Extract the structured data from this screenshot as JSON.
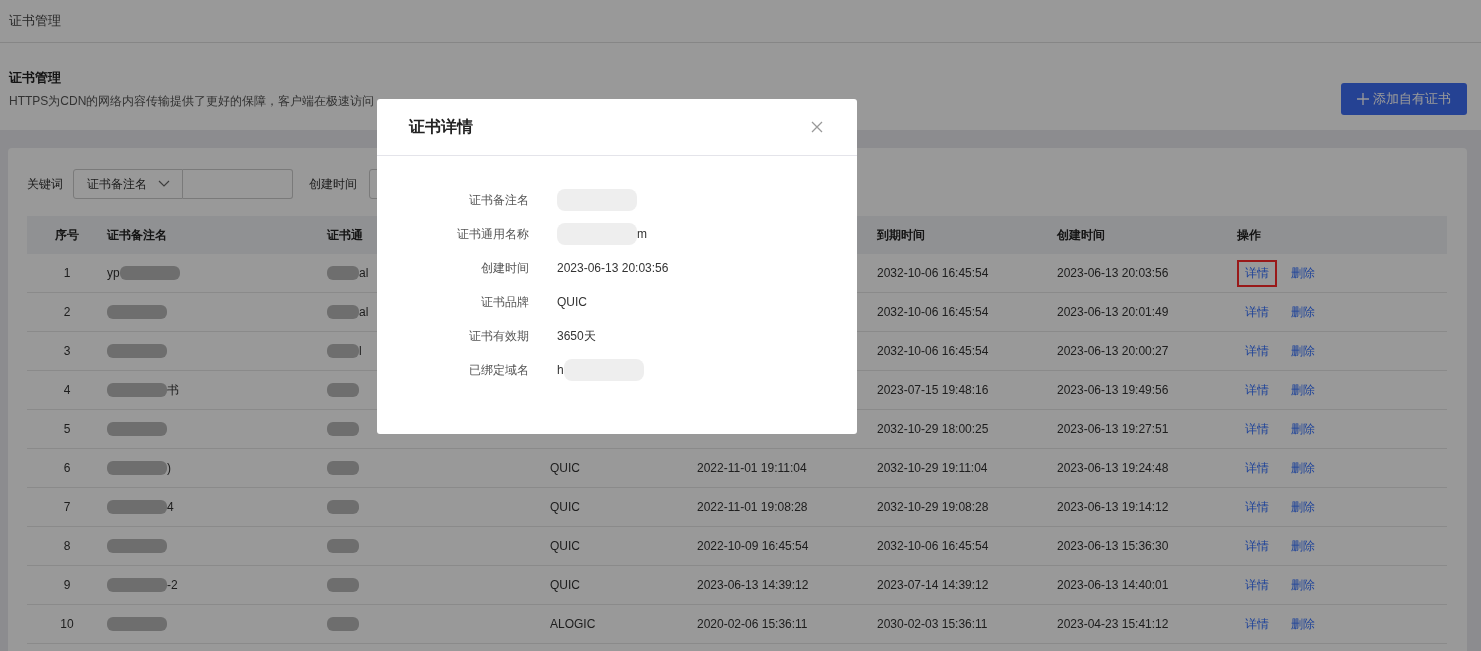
{
  "header": {
    "title": "证书管理"
  },
  "section": {
    "title": "证书管理",
    "description": "HTTPS为CDN的网络内容传输提供了更好的保障，客户端在极速访问",
    "add_button": "添加自有证书"
  },
  "filters": {
    "keyword_label": "关键词",
    "keyword_select": "证书备注名",
    "created_label": "创建时间"
  },
  "table": {
    "columns": [
      "序号",
      "证书备注名",
      "证书通",
      "到期时间",
      "创建时间",
      "操作"
    ],
    "rows": [
      {
        "index": "1",
        "name": {
          "text": "yp",
          "redacted_after": true
        },
        "common": {
          "text": "al",
          "redacted_before": true
        },
        "expire": "2032-10-06 16:45:54",
        "created": "2023-06-13 20:03:56",
        "actions": [
          {
            "label": "详情",
            "highlighted": true
          },
          {
            "label": "删除",
            "highlighted": false
          }
        ]
      },
      {
        "index": "2",
        "name": {
          "redacted_before": true
        },
        "common": {
          "text": "al",
          "redacted_before": true
        },
        "expire": "2032-10-06 16:45:54",
        "created": "2023-06-13 20:01:49",
        "actions": [
          {
            "label": "详情",
            "highlighted": false
          },
          {
            "label": "删除",
            "highlighted": false
          }
        ]
      },
      {
        "index": "3",
        "name": {
          "redacted_before": true
        },
        "common": {
          "text": "l",
          "redacted_before": true
        },
        "expire": "2032-10-06 16:45:54",
        "created": "2023-06-13 20:00:27",
        "actions": [
          {
            "label": "详情",
            "highlighted": false
          },
          {
            "label": "删除",
            "highlighted": false
          }
        ]
      },
      {
        "index": "4",
        "name": {
          "text": "书",
          "redacted_before": true
        },
        "common": {
          "redacted_before": true
        },
        "expire": "2023-07-15 19:48:16",
        "created": "2023-06-13 19:49:56",
        "actions": [
          {
            "label": "详情",
            "highlighted": false
          },
          {
            "label": "删除",
            "highlighted": false
          }
        ]
      },
      {
        "index": "5",
        "name": {
          "redacted_before": true
        },
        "common": {
          "redacted_before": true
        },
        "expire": "2032-10-29 18:00:25",
        "created": "2023-06-13 19:27:51",
        "actions": [
          {
            "label": "详情",
            "highlighted": false
          },
          {
            "label": "删除",
            "highlighted": false
          }
        ]
      },
      {
        "index": "6",
        "name": {
          "text": ")",
          "redacted_before": true
        },
        "common": {
          "redacted_before": true
        },
        "brand": "QUIC",
        "start": "2022-11-01 19:11:04",
        "expire": "2032-10-29 19:11:04",
        "created": "2023-06-13 19:24:48",
        "actions": [
          {
            "label": "详情",
            "highlighted": false
          },
          {
            "label": "删除",
            "highlighted": false
          }
        ]
      },
      {
        "index": "7",
        "name": {
          "text": "4",
          "redacted_before": true
        },
        "common": {
          "redacted_before": true
        },
        "brand": "QUIC",
        "start": "2022-11-01 19:08:28",
        "expire": "2032-10-29 19:08:28",
        "created": "2023-06-13 19:14:12",
        "actions": [
          {
            "label": "详情",
            "highlighted": false
          },
          {
            "label": "删除",
            "highlighted": false
          }
        ]
      },
      {
        "index": "8",
        "name": {
          "redacted_before": true
        },
        "common": {
          "redacted_before": true
        },
        "brand": "QUIC",
        "start": "2022-10-09 16:45:54",
        "expire": "2032-10-06 16:45:54",
        "created": "2023-06-13 15:36:30",
        "actions": [
          {
            "label": "详情",
            "highlighted": false
          },
          {
            "label": "删除",
            "highlighted": false
          }
        ]
      },
      {
        "index": "9",
        "name": {
          "text": "-2",
          "redacted_before": true
        },
        "common": {
          "redacted_before": true
        },
        "brand": "QUIC",
        "start": "2023-06-13 14:39:12",
        "expire": "2023-07-14 14:39:12",
        "created": "2023-06-13 14:40:01",
        "actions": [
          {
            "label": "详情",
            "highlighted": false
          },
          {
            "label": "删除",
            "highlighted": false
          }
        ]
      },
      {
        "index": "10",
        "name": {
          "redacted_before": true
        },
        "common": {
          "redacted_before": true
        },
        "brand": "ALOGIC",
        "start": "2020-02-06 15:36:11",
        "expire": "2030-02-03 15:36:11",
        "created": "2023-04-23 15:41:12",
        "actions": [
          {
            "label": "详情",
            "highlighted": false
          },
          {
            "label": "删除",
            "highlighted": false
          }
        ]
      }
    ]
  },
  "dialog": {
    "title": "证书详情",
    "fields": [
      {
        "label": "证书备注名",
        "redacted_before": true
      },
      {
        "label": "证书通用名称",
        "value": "m",
        "redacted_before": true
      },
      {
        "label": "创建时间",
        "value": "2023-06-13 20:03:56"
      },
      {
        "label": "证书品牌",
        "value": "QUIC"
      },
      {
        "label": "证书有效期",
        "value": "3650天"
      },
      {
        "label": "已绑定域名",
        "value": "h",
        "redacted_after": true
      }
    ]
  }
}
